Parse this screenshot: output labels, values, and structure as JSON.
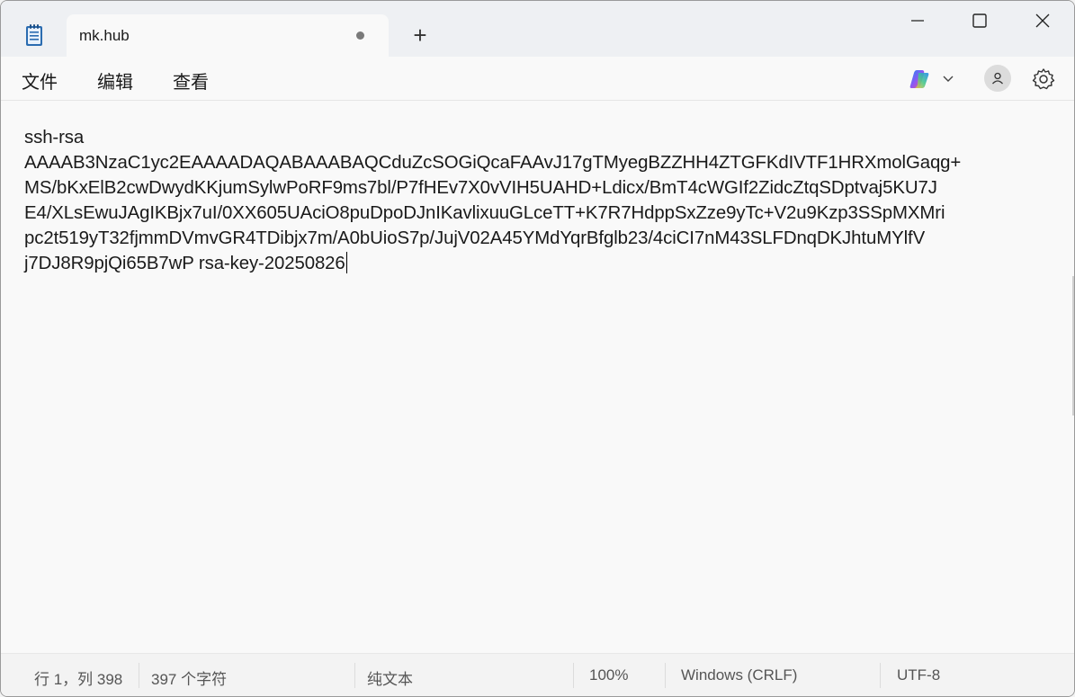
{
  "tab": {
    "title": "mk.hub",
    "new_tab_symbol": "+"
  },
  "window_controls": {
    "minimize_icon": "minimize-icon",
    "maximize_icon": "maximize-icon",
    "close_icon": "close-icon"
  },
  "menu": {
    "file": "文件",
    "edit": "编辑",
    "view": "查看"
  },
  "toolbar_right": {
    "copilot_icon": "copilot-icon",
    "account_icon": "account-icon",
    "settings_icon": "gear-icon"
  },
  "editor": {
    "lines": [
      "ssh-rsa",
      "AAAAB3NzaC1yc2EAAAADAQABAAABAQCduZcSOGiQcaFAAvJ17gTMyegBZZHH4ZTGFKdIVTF1HRXmolGaqg+",
      "MS/bKxElB2cwDwydKKjumSylwPoRF9ms7bl/P7fHEv7X0vVIH5UAHD+Ldicx/BmT4cWGIf2ZidcZtqSDptvaj5KU7J",
      "E4/XLsEwuJAgIKBjx7uI/0XX605UAciO8puDpoDJnIKavlixuuGLceTT+K7R7HdppSxZze9yTc+V2u9Kzp3SSpMXMri",
      "pc2t519yT32fjmmDVmvGR4TDibjx7m/A0bUioS7p/JujV02A45YMdYqrBfglb23/4ciCI7nM43SLFDnqDKJhtuMYlfV",
      "j7DJ8R9pjQi65B7wP rsa-key-20250826"
    ]
  },
  "status": {
    "position": "行 1，列 398",
    "chars": "397 个字符",
    "format": "纯文本",
    "zoom": "100%",
    "line_ending": "Windows (CRLF)",
    "encoding": "UTF-8"
  },
  "colors": {
    "titlebar": "#eef0f3",
    "editor_bg": "#f9f9f9",
    "statusbar": "#f3f3f3"
  }
}
